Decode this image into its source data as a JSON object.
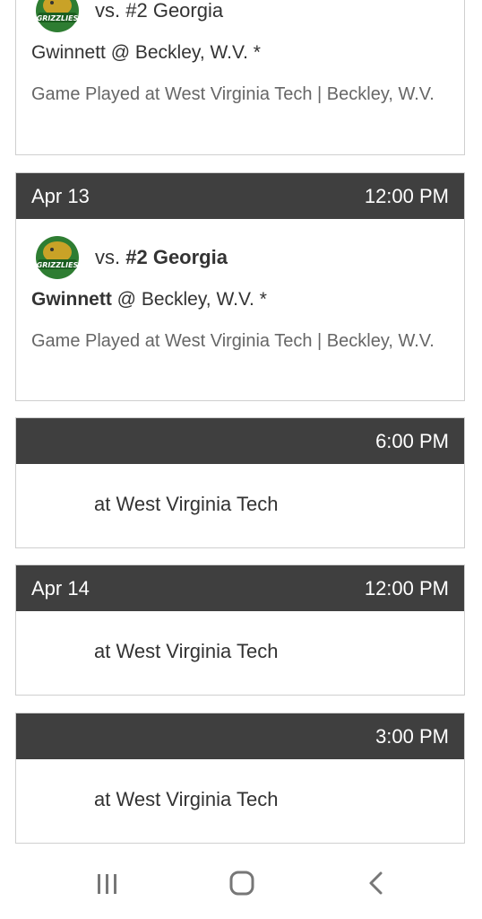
{
  "games": [
    {
      "date": "",
      "time": "",
      "logo": "georgia-gwinnett-grizzlies-logo",
      "vs_prefix": "vs.",
      "opponent": "#2 Georgia",
      "home_team": "Gwinnett",
      "location": "@ Beckley, W.V. *",
      "note": "Game Played at West Virginia Tech | Beckley, W.V."
    },
    {
      "date": "Apr 13",
      "time": "12:00 PM",
      "logo": "georgia-gwinnett-grizzlies-logo",
      "vs_prefix": "vs.",
      "opponent": "#2 Georgia",
      "home_team": "Gwinnett",
      "location": "@ Beckley, W.V. *",
      "note": "Game Played at West Virginia Tech | Beckley, W.V."
    },
    {
      "date": "",
      "time": "6:00 PM",
      "at_text": "at West Virginia Tech"
    },
    {
      "date": "Apr 14",
      "time": "12:00 PM",
      "at_text": "at West Virginia Tech"
    },
    {
      "date": "",
      "time": "3:00 PM",
      "at_text": "at West Virginia Tech"
    }
  ],
  "logo_text": "GRIZZLIES",
  "colors": {
    "header_bg": "#3f3f3f",
    "logo_green": "#2e7d32",
    "logo_gold": "#c9a227"
  },
  "nav": {
    "recent": "recent-apps-icon",
    "home": "home-icon",
    "back": "back-icon"
  }
}
